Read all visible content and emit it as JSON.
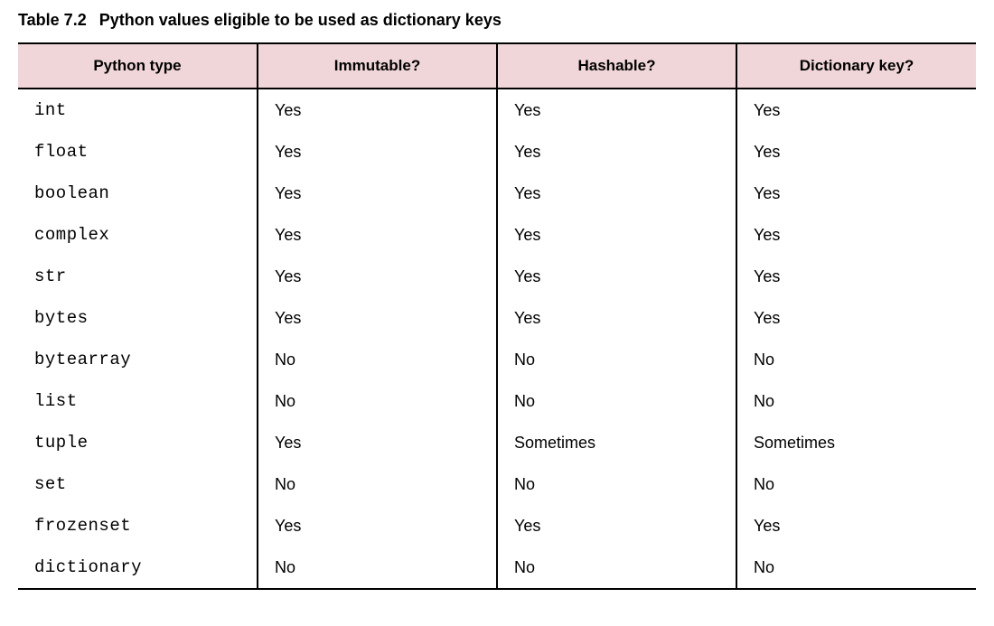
{
  "caption": {
    "label": "Table 7.2",
    "title": "Python values eligible to be used as dictionary keys"
  },
  "headers": {
    "col1": "Python type",
    "col2": "Immutable?",
    "col3": "Hashable?",
    "col4": "Dictionary key?"
  },
  "chart_data": {
    "type": "table",
    "columns": [
      "Python type",
      "Immutable?",
      "Hashable?",
      "Dictionary key?"
    ],
    "rows": [
      {
        "type": "int",
        "immutable": "Yes",
        "hashable": "Yes",
        "dictkey": "Yes"
      },
      {
        "type": "float",
        "immutable": "Yes",
        "hashable": "Yes",
        "dictkey": "Yes"
      },
      {
        "type": "boolean",
        "immutable": "Yes",
        "hashable": "Yes",
        "dictkey": "Yes"
      },
      {
        "type": "complex",
        "immutable": "Yes",
        "hashable": "Yes",
        "dictkey": "Yes"
      },
      {
        "type": "str",
        "immutable": "Yes",
        "hashable": "Yes",
        "dictkey": "Yes"
      },
      {
        "type": "bytes",
        "immutable": "Yes",
        "hashable": "Yes",
        "dictkey": "Yes"
      },
      {
        "type": "bytearray",
        "immutable": "No",
        "hashable": "No",
        "dictkey": "No"
      },
      {
        "type": "list",
        "immutable": "No",
        "hashable": "No",
        "dictkey": "No"
      },
      {
        "type": "tuple",
        "immutable": "Yes",
        "hashable": "Sometimes",
        "dictkey": "Sometimes"
      },
      {
        "type": "set",
        "immutable": "No",
        "hashable": "No",
        "dictkey": "No"
      },
      {
        "type": "frozenset",
        "immutable": "Yes",
        "hashable": "Yes",
        "dictkey": "Yes"
      },
      {
        "type": "dictionary",
        "immutable": "No",
        "hashable": "No",
        "dictkey": "No"
      }
    ]
  }
}
